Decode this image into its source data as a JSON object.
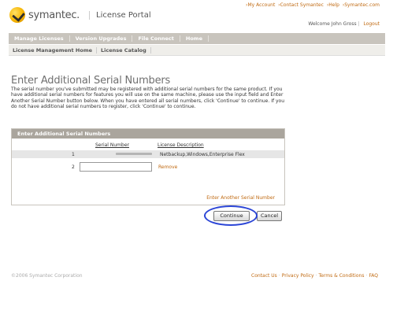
{
  "top_links": [
    "›My Account",
    "›Contact Symantec",
    "›Help",
    "›Symantec.com"
  ],
  "logo": {
    "text": "symantec."
  },
  "portal_title": "License Portal",
  "welcome": {
    "text": "Welcome John Gross",
    "logout": "Logout"
  },
  "nav_primary": [
    "Manage Licenses",
    "Version Upgrades",
    "File Connect",
    "Home"
  ],
  "nav_secondary": [
    "License Management Home",
    "License Catalog"
  ],
  "page_title": "Enter Additional Serial Numbers",
  "intro_text": "The serial number you've submitted may be registered with additional serial numbers for the same product. If you have additional serial numbers for features you will use on the same machine, please use the input field and Enter Another Serial Number button below. When you have entered all serial numbers, click 'Continue' to continue. If you do not have additional serial numbers to register, click 'Continue' to continue.",
  "panel": {
    "header": "Enter Additional Serial Numbers",
    "col_serial": "Serial Number",
    "col_license": "License Description",
    "rows": [
      {
        "num": "1",
        "license": "Netbackup,Windows,Enterprise Flex"
      },
      {
        "num": "2",
        "input_value": "",
        "remove": "Remove"
      }
    ],
    "enter_another": "Enter Another Serial Number"
  },
  "buttons": {
    "continue": "Continue",
    "cancel": "Cancel"
  },
  "footer": {
    "copyright": "©2006 Symantec Corporation",
    "links": [
      "Contact Us",
      "Privacy Policy",
      "Terms & Conditions",
      "FAQ"
    ]
  },
  "colors": {
    "link_orange": "#c06a12",
    "nav_bar": "#c8c4bd",
    "panel_header": "#aaa59d",
    "highlight_blue": "#2b45d6"
  },
  "icons": [
    "symantec-logo-icon"
  ]
}
